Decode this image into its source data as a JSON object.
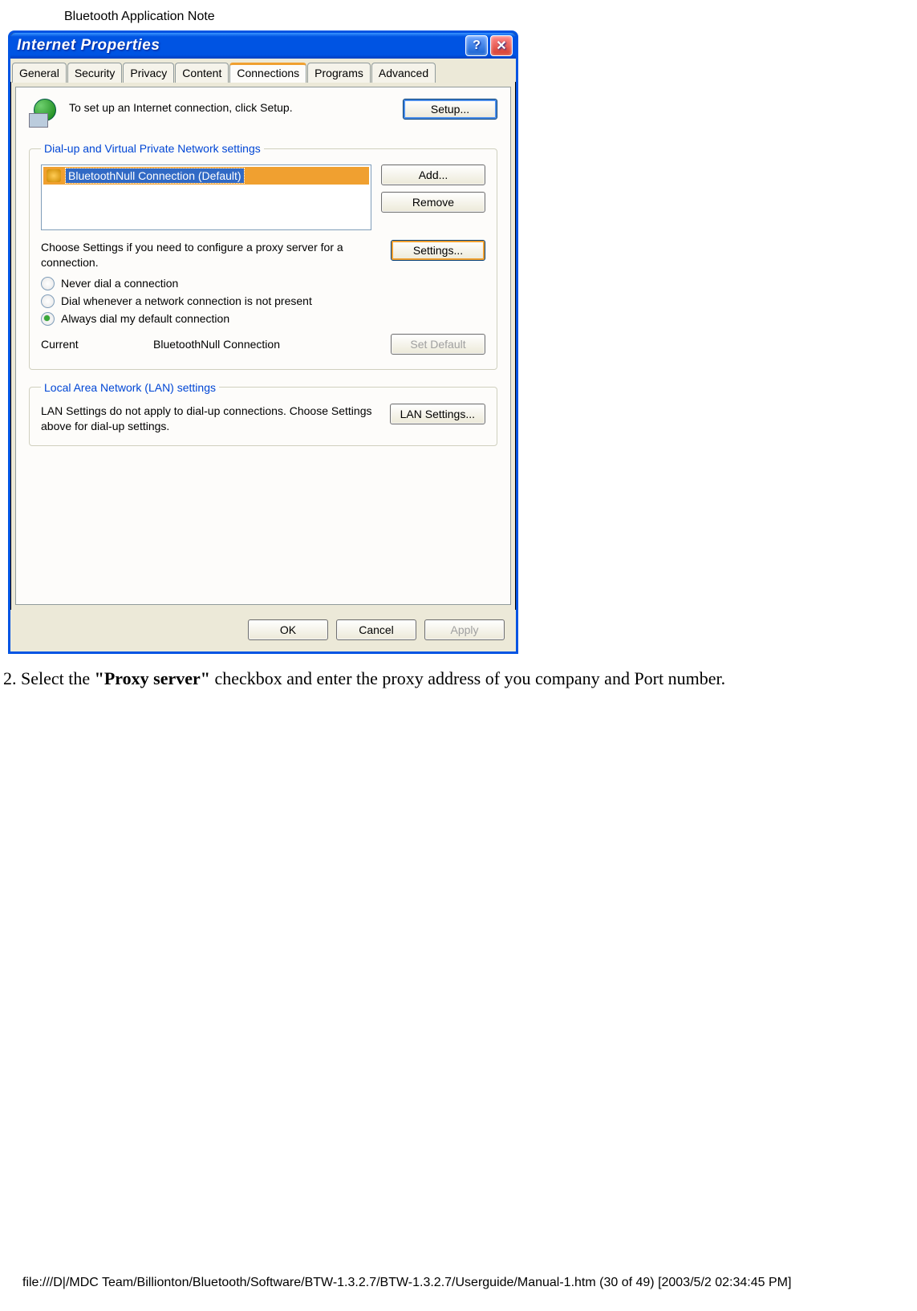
{
  "page": {
    "header": "Bluetooth Application Note",
    "footer": "file:///D|/MDC Team/Billionton/Bluetooth/Software/BTW-1.3.2.7/BTW-1.3.2.7/Userguide/Manual-1.htm (30 of 49) [2003/5/2 02:34:45 PM]"
  },
  "dialog": {
    "title": "Internet Properties",
    "tabs": [
      "General",
      "Security",
      "Privacy",
      "Content",
      "Connections",
      "Programs",
      "Advanced"
    ],
    "active_tab": "Connections",
    "setup_text": "To set up an Internet connection, click Setup.",
    "setup_button": "Setup...",
    "group1": {
      "legend": "Dial-up and Virtual Private Network settings",
      "list_item": "BluetoothNull Connection (Default)",
      "add_button": "Add...",
      "remove_button": "Remove",
      "settings_text": "Choose Settings if you need to configure a proxy server for a connection.",
      "settings_button": "Settings...",
      "radio1": "Never dial a connection",
      "radio2": "Dial whenever a network connection is not present",
      "radio3": "Always dial my default connection",
      "current_label": "Current",
      "current_value": "BluetoothNull Connection",
      "set_default_button": "Set Default"
    },
    "group2": {
      "legend": "Local Area Network (LAN) settings",
      "text": "LAN Settings do not apply to dial-up connections. Choose Settings above for dial-up settings.",
      "lan_button": "LAN Settings..."
    },
    "buttons": {
      "ok": "OK",
      "cancel": "Cancel",
      "apply": "Apply"
    }
  },
  "instruction": {
    "prefix": "2. Select the ",
    "bold": "\"Proxy server\"",
    "suffix": " checkbox and enter the proxy address of you company and Port number."
  }
}
